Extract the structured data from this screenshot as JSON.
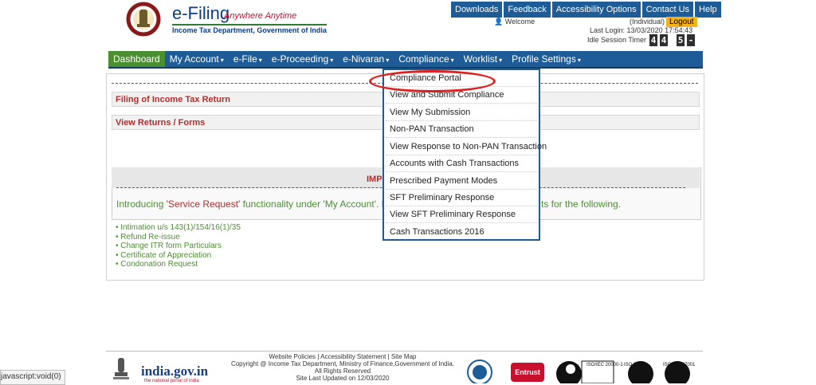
{
  "header": {
    "brand": "e-Filing",
    "tagline": "Anywhere Anytime",
    "subtitle": "Income Tax Department, Government of India",
    "top_links": [
      "Downloads",
      "Feedback",
      "Accessibility Options",
      "Contact Us",
      "Help"
    ],
    "welcome": "Welcome",
    "role": "(Individual)",
    "logout": "Logout",
    "last_login": "Last Login: 13/03/2020 17:54:43",
    "timer_label": "Idle Session Timer",
    "timer_digits": [
      "4",
      "4",
      "5",
      "-"
    ]
  },
  "nav": {
    "items": [
      {
        "label": "Dashboard",
        "active": true,
        "caret": ""
      },
      {
        "label": "My Account",
        "caret": "▾"
      },
      {
        "label": "e-File",
        "caret": "▾"
      },
      {
        "label": "e-Proceeding",
        "caret": "▾"
      },
      {
        "label": "e-Nivaran",
        "caret": "▾"
      },
      {
        "label": "Compliance",
        "caret": "▾"
      },
      {
        "label": "Worklist",
        "caret": "▾"
      },
      {
        "label": "Profile Settings",
        "caret": "▾"
      }
    ]
  },
  "main": {
    "filing_header": "Filing of Income Tax Return",
    "view_returns": "View Returns / Forms",
    "notice_title": "IMP",
    "notice_text_pre": "Introducing ",
    "notice_text_quote": "'Service Request'",
    "notice_text_mid": " functionality under 'My Account'. N",
    "notice_tail": "ts for the following.",
    "list": [
      "Intimation u/s 143(1)/154/16(1)/35",
      "Refund Re-issue",
      "Change ITR form Particulars",
      "Certificate of Appreciation",
      "Condonation Request"
    ]
  },
  "dropdown": {
    "items": [
      "Compliance Portal",
      "View and Submit Compliance",
      "View My Submission",
      "Non-PAN Transaction",
      "View Response to Non-PAN Transaction",
      "Accounts with Cash Transactions",
      "Prescribed Payment Modes",
      "SFT Preliminary Response",
      "View SFT Preliminary Response",
      "Cash Transactions 2016"
    ]
  },
  "footer": {
    "links": "Website Policies  |  Accessibility Statement  |  Site Map",
    "copyright": "Copyright @ Income Tax Department, Ministry of Finance,Government of India.",
    "rights": "All Rights Reserved",
    "updated": "Site Last Updated on 12/03/2020",
    "indiagov": "india.gov.in",
    "indiagov_sub": "the national portal of india",
    "certs": [
      "Entrust",
      "ISO/IEC 20000-1",
      "ISO 22301",
      "ISO/IEC 27001"
    ]
  },
  "status": "javascript:void(0)"
}
